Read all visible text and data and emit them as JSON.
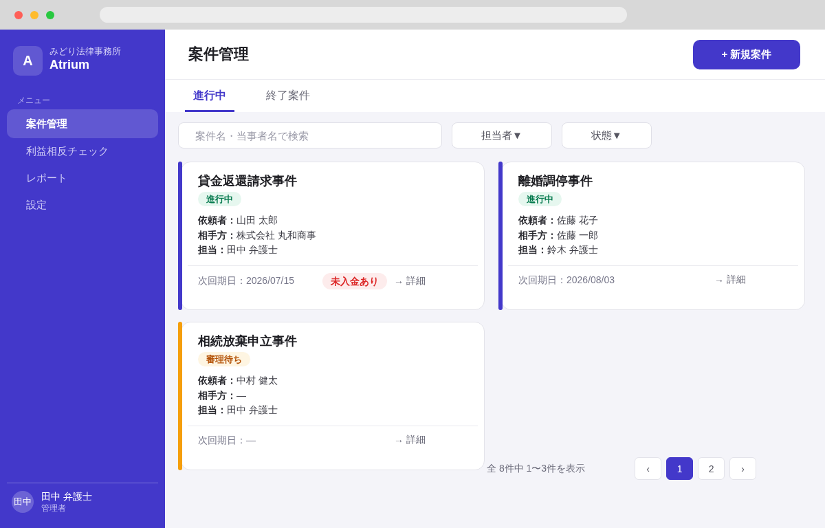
{
  "sidebar": {
    "logo": "A",
    "firm_name": "みどり法律事務所",
    "app_name": "Atrium",
    "section_label": "メニュー",
    "items": [
      {
        "label": "案件管理",
        "selected": true
      },
      {
        "label": "利益相反チェック",
        "selected": false
      },
      {
        "label": "レポート",
        "selected": false
      },
      {
        "label": "設定",
        "selected": false
      }
    ],
    "user": {
      "avatar": "田中",
      "name": "田中 弁護士",
      "role": "管理者"
    }
  },
  "header": {
    "title": "案件管理",
    "new_button": "+ 新規案件"
  },
  "tabs": [
    {
      "label": "進行中",
      "selected": true
    },
    {
      "label": "終了案件",
      "selected": false
    }
  ],
  "filters": {
    "search": {
      "placeholder": "案件名・当事者名で検索"
    },
    "dropdowns": [
      "担当者▼",
      "状態▼"
    ]
  },
  "cases": [
    {
      "color": "#4338ca",
      "title": "貸金返還請求事件",
      "status": {
        "label": "進行中",
        "kind": "active"
      },
      "details": [
        "**依頼者：**山田 太郎",
        "**相手方：**株式会社 丸和商事",
        "**担当：**田中 弁護士"
      ],
      "next_date": "次回期日：2026/07/15",
      "alert": "未入金あり",
      "link": "→ 詳細"
    },
    {
      "color": "#4338ca",
      "title": "離婚調停事件",
      "status": {
        "label": "進行中",
        "kind": "active"
      },
      "details": [
        "**依頼者：**佐藤 花子",
        "**相手方：**佐藤 一郎",
        "**担当：**鈴木 弁護士"
      ],
      "next_date": "次回期日：2026/08/03",
      "link": "→ 詳細"
    },
    {
      "color": "#f59e0b",
      "title": "相続放棄申立事件",
      "status": {
        "label": "審理待ち",
        "kind": "pending"
      },
      "details": [
        "**依頼者：**中村 健太",
        "**相手方：**—",
        "**担当：**田中 弁護士"
      ],
      "next_date": "次回期日：—",
      "link": "→ 詳細"
    }
  ],
  "pagination": {
    "summary": "全 8件中 1〜3件を表示",
    "prev": "‹",
    "pages": [
      {
        "label": "1",
        "selected": true
      },
      {
        "label": "2",
        "selected": false
      }
    ],
    "next": "›"
  }
}
